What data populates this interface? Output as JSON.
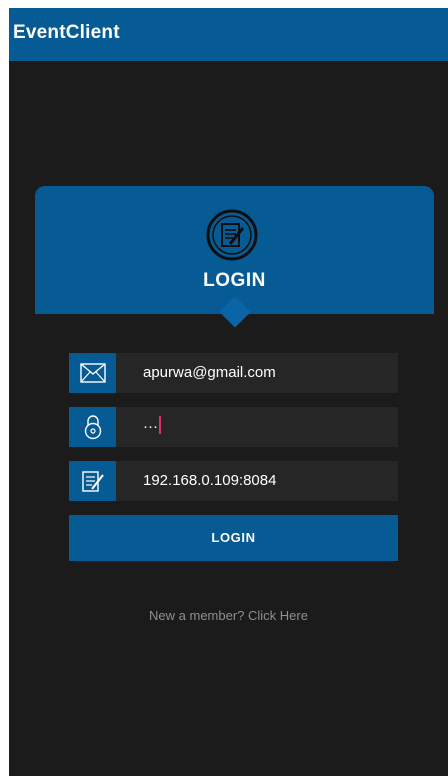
{
  "app": {
    "title": "EventClient"
  },
  "header": {
    "icon": "notepad-pencil-icon",
    "title": "LOGIN"
  },
  "form": {
    "email": {
      "icon": "envelope-icon",
      "value": "apurwa@gmail.com"
    },
    "password": {
      "icon": "lock-icon",
      "masked_value": "···"
    },
    "server": {
      "icon": "notepad-pencil-icon",
      "value": "192.168.0.109:8084"
    },
    "login_button": "LOGIN"
  },
  "register_link": "New a member? Click Here",
  "colors": {
    "primary": "#075b94",
    "background": "#1b1b1b",
    "field_background": "#262626",
    "caret": "#e0306a",
    "link_text": "#8f8f8f"
  }
}
